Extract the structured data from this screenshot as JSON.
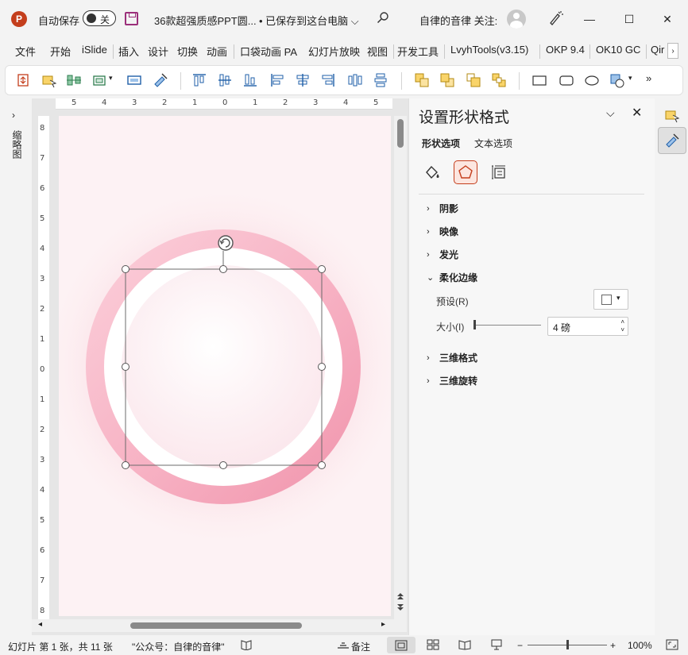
{
  "titlebar": {
    "logo": "P",
    "autosave_label": "自动保存",
    "autosave_state": "关",
    "doc_title": "36款超强质感PPT圆...",
    "save_status": "• 已保存到这台电脑 ⌵",
    "user": "自律的音律 关注:",
    "icons": [
      "save-icon",
      "search-icon",
      "avatar",
      "pen-icon"
    ],
    "window_buttons": {
      "minimize": "—",
      "maximize": "☐",
      "close": "✕"
    }
  },
  "menu": {
    "items": [
      "文件",
      "开始",
      "iSlide",
      "插入",
      "设计",
      "切换",
      "动画",
      "口袋动画 PA",
      "幻灯片放映",
      "视图",
      "开发工具",
      "LvyhTools(v3.15)",
      "OKP 9.4",
      "OK10 GC",
      "Qir"
    ],
    "scroll_label": "›"
  },
  "ribbon": {
    "more_label": "»"
  },
  "left_pane": {
    "expand_label": "›",
    "label": "缩略图"
  },
  "ruler": {
    "h_ticks": [
      "5",
      "4",
      "3",
      "2",
      "1",
      "0",
      "1",
      "2",
      "3",
      "4",
      "5"
    ],
    "v_ticks": [
      "8",
      "7",
      "6",
      "5",
      "4",
      "3",
      "2",
      "1",
      "0",
      "1",
      "2",
      "3",
      "4",
      "5",
      "6",
      "7",
      "8"
    ]
  },
  "format_pane": {
    "title": "设置形状格式",
    "tabs": {
      "shape": "形状选项",
      "text": "文本选项"
    },
    "sections": {
      "shadow": "阴影",
      "reflection": "映像",
      "glow": "发光",
      "soft_edges": "柔化边缘",
      "format_3d": "三维格式",
      "rotation_3d": "三维旋转"
    },
    "soft_edges": {
      "preset_label": "预设(R)",
      "size_label": "大小(I)",
      "size_value": "4 磅",
      "size_fraction": 0.0
    }
  },
  "statusbar": {
    "slide_info": "幻灯片 第 1 张，共 11 张",
    "quote": "\"公众号：自律的音律\"",
    "notes": "备注",
    "zoom_minus": "−",
    "zoom_plus": "+",
    "zoom": "100%",
    "zoom_fraction": 0.5
  },
  "colors": {
    "accent": "#c43e1c",
    "ring": "#f4a3b8",
    "slide_bg": "#fdf1f3"
  }
}
